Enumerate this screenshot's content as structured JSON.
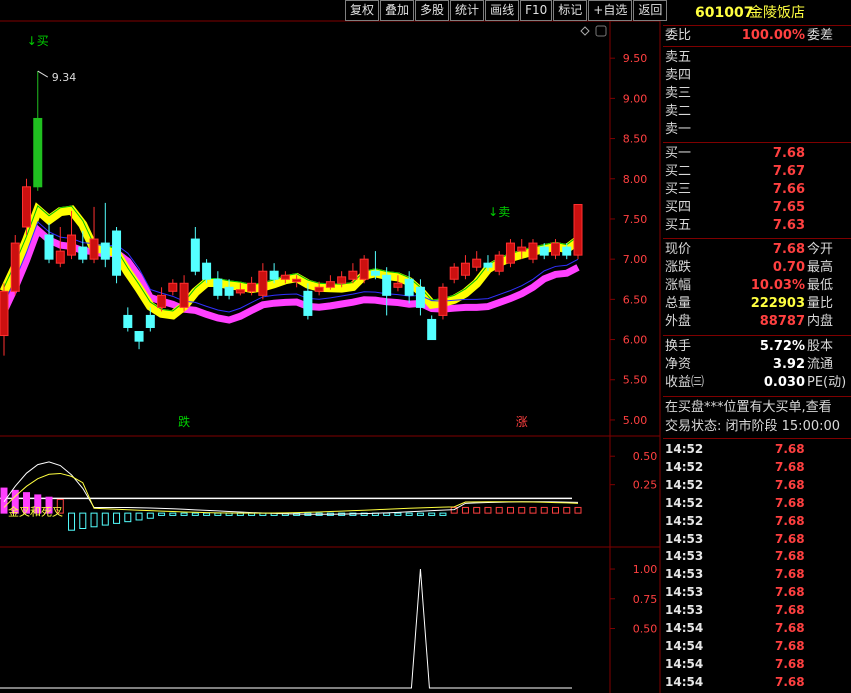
{
  "toolbar": {
    "buttons": [
      "复权",
      "叠加",
      "多股",
      "统计",
      "画线",
      "F10",
      "标记",
      "+自选",
      "返回"
    ]
  },
  "stock": {
    "code": "601007",
    "name": "金陵饭店"
  },
  "quote": {
    "weibi_label": "委比",
    "weibi_value": "100.00%",
    "weicha_label": "委差",
    "sell": [
      {
        "label": "卖五"
      },
      {
        "label": "卖四"
      },
      {
        "label": "卖三"
      },
      {
        "label": "卖二"
      },
      {
        "label": "卖一"
      }
    ],
    "buy": [
      {
        "label": "买一",
        "price": "7.68"
      },
      {
        "label": "买二",
        "price": "7.67"
      },
      {
        "label": "买三",
        "price": "7.66"
      },
      {
        "label": "买四",
        "price": "7.65"
      },
      {
        "label": "买五",
        "price": "7.63"
      }
    ],
    "stats": [
      {
        "label": "现价",
        "value": "7.68",
        "right": "今开",
        "color": "red"
      },
      {
        "label": "涨跌",
        "value": "0.70",
        "right": "最高",
        "color": "red"
      },
      {
        "label": "涨幅",
        "value": "10.03%",
        "right": "最低",
        "color": "red"
      },
      {
        "label": "总量",
        "value": "222903",
        "right": "量比",
        "color": "yel"
      },
      {
        "label": "外盘",
        "value": "88787",
        "right": "内盘",
        "color": "red"
      }
    ],
    "stats2": [
      {
        "label": "换手",
        "value": "5.72%",
        "right": "股本"
      },
      {
        "label": "净资",
        "value": "3.92",
        "right": "流通"
      },
      {
        "label": "收益㈢",
        "value": "0.030",
        "right": "PE(动)"
      }
    ],
    "notice": "在买盘***位置有大买单,查看",
    "status": "交易状态: 闭市阶段 15:00:00"
  },
  "ticks": [
    {
      "time": "14:52",
      "price": "7.68"
    },
    {
      "time": "14:52",
      "price": "7.68"
    },
    {
      "time": "14:52",
      "price": "7.68"
    },
    {
      "time": "14:52",
      "price": "7.68"
    },
    {
      "time": "14:52",
      "price": "7.68"
    },
    {
      "time": "14:53",
      "price": "7.68"
    },
    {
      "time": "14:53",
      "price": "7.68"
    },
    {
      "time": "14:53",
      "price": "7.68"
    },
    {
      "time": "14:53",
      "price": "7.68"
    },
    {
      "time": "14:53",
      "price": "7.68"
    },
    {
      "time": "14:54",
      "price": "7.68"
    },
    {
      "time": "14:54",
      "price": "7.68"
    },
    {
      "time": "14:54",
      "price": "7.68"
    },
    {
      "time": "14:54",
      "price": "7.68"
    }
  ],
  "chart_data": {
    "type": "candlestick",
    "main": {
      "yticks": [
        "9.50",
        "9.00",
        "8.50",
        "8.00",
        "7.50",
        "7.00",
        "6.50",
        "6.00",
        "5.50",
        "5.00"
      ],
      "ylim": [
        4.85,
        9.95
      ],
      "high_annotation": "9.34",
      "markers": [
        {
          "text": "↓买",
          "color": "#00d000",
          "x_index": 3
        },
        {
          "text": "↓卖",
          "color": "#00d000",
          "x_index": 44
        },
        {
          "text": "跌",
          "color": "#00d000",
          "x_index": 16
        },
        {
          "text": "涨",
          "color": "#ff4040",
          "x_index": 46
        }
      ],
      "candles": [
        [
          6.05,
          6.6,
          6.7,
          5.8
        ],
        [
          6.6,
          7.2,
          7.3,
          6.55
        ],
        [
          7.4,
          7.9,
          8.0,
          7.3
        ],
        [
          7.9,
          8.75,
          9.34,
          7.85
        ],
        [
          7.3,
          7.0,
          7.45,
          6.95
        ],
        [
          6.95,
          7.1,
          7.4,
          6.9
        ],
        [
          7.05,
          7.3,
          7.6,
          7.0
        ],
        [
          7.15,
          7.0,
          7.35,
          6.95
        ],
        [
          7.0,
          7.25,
          7.65,
          6.95
        ],
        [
          7.2,
          7.0,
          7.7,
          6.9
        ],
        [
          7.35,
          6.8,
          7.4,
          6.7
        ],
        [
          6.3,
          6.15,
          6.4,
          6.1
        ],
        [
          6.1,
          5.98,
          6.1,
          5.88
        ],
        [
          6.3,
          6.15,
          6.4,
          6.1
        ],
        [
          6.4,
          6.55,
          6.65,
          6.35
        ],
        [
          6.6,
          6.7,
          6.75,
          6.55
        ],
        [
          6.4,
          6.7,
          6.8,
          6.35
        ],
        [
          7.25,
          6.85,
          7.4,
          6.8
        ],
        [
          6.95,
          6.75,
          7.0,
          6.7
        ],
        [
          6.75,
          6.55,
          6.85,
          6.5
        ],
        [
          6.65,
          6.55,
          6.75,
          6.5
        ],
        [
          6.58,
          6.62,
          6.7,
          6.55
        ],
        [
          6.6,
          6.7,
          6.78,
          6.55
        ],
        [
          6.55,
          6.85,
          6.95,
          6.5
        ],
        [
          6.85,
          6.75,
          6.95,
          6.7
        ],
        [
          6.75,
          6.8,
          6.85,
          6.7
        ],
        [
          6.72,
          6.75,
          6.8,
          6.65
        ],
        [
          6.6,
          6.3,
          6.7,
          6.25
        ],
        [
          6.6,
          6.65,
          6.72,
          6.55
        ],
        [
          6.65,
          6.72,
          6.8,
          6.62
        ],
        [
          6.7,
          6.78,
          6.85,
          6.65
        ],
        [
          6.75,
          6.85,
          6.95,
          6.7
        ],
        [
          6.75,
          7.0,
          7.05,
          6.7
        ],
        [
          6.85,
          6.8,
          7.1,
          6.75
        ],
        [
          6.8,
          6.55,
          6.9,
          6.3
        ],
        [
          6.65,
          6.7,
          6.8,
          6.6
        ],
        [
          6.75,
          6.55,
          6.85,
          6.45
        ],
        [
          6.65,
          6.4,
          6.75,
          6.3
        ],
        [
          6.25,
          6.0,
          6.3,
          6.0
        ],
        [
          6.3,
          6.65,
          6.7,
          6.25
        ],
        [
          6.75,
          6.9,
          6.95,
          6.7
        ],
        [
          6.8,
          6.95,
          7.05,
          6.75
        ],
        [
          6.9,
          7.0,
          7.1,
          6.85
        ],
        [
          6.95,
          6.9,
          7.05,
          6.85
        ],
        [
          6.85,
          7.05,
          7.1,
          6.8
        ],
        [
          6.95,
          7.2,
          7.25,
          6.9
        ],
        [
          7.1,
          7.15,
          7.25,
          7.0
        ],
        [
          7.0,
          7.2,
          7.25,
          6.95
        ],
        [
          7.15,
          7.05,
          7.2,
          7.0
        ],
        [
          7.05,
          7.2,
          7.25,
          7.0
        ],
        [
          7.15,
          7.05,
          7.2,
          7.0
        ],
        [
          7.05,
          7.68,
          7.68,
          7.0
        ]
      ]
    },
    "macd": {
      "yticks": [
        "0.50",
        "0.25"
      ],
      "ylim": [
        -0.28,
        0.66
      ],
      "label": "金叉和死叉"
    },
    "vol": {
      "yticks": [
        "1.00",
        "0.75",
        "0.50"
      ],
      "ylim": [
        0,
        1.16
      ]
    }
  }
}
